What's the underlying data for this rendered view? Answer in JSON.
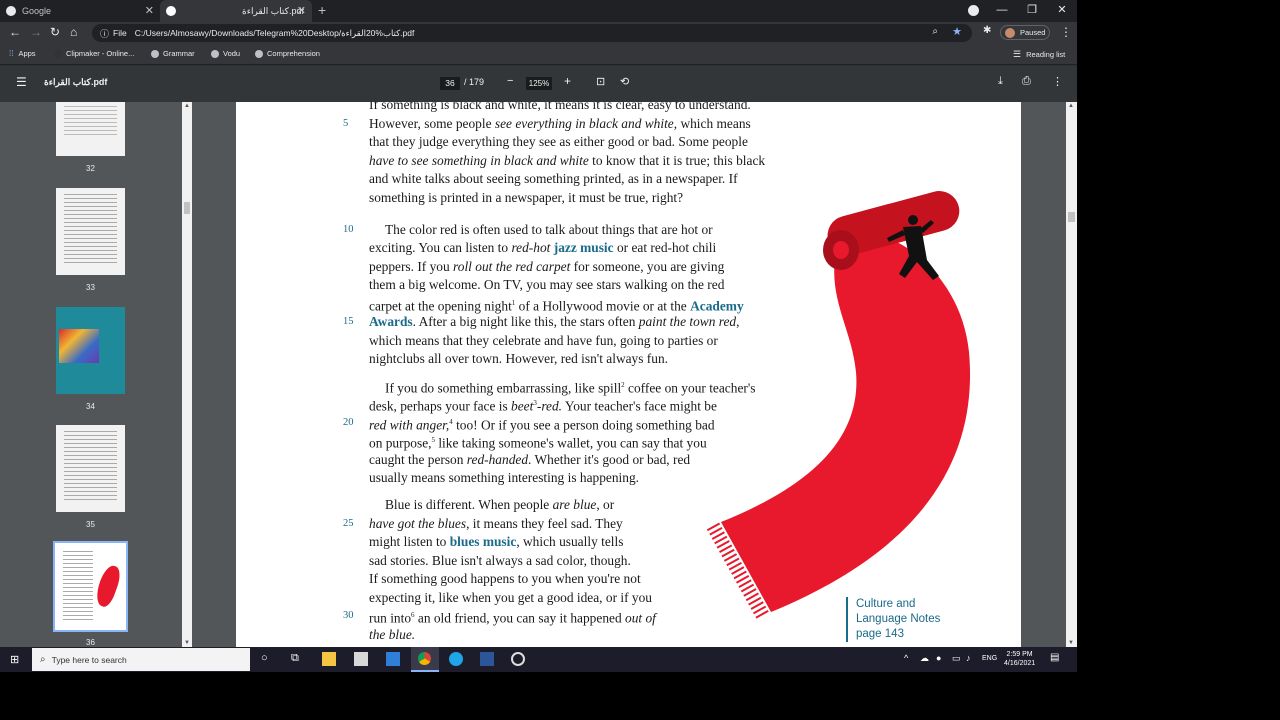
{
  "tabs": [
    {
      "label": "Google"
    },
    {
      "label": "كتاب القراءة.pdf"
    }
  ],
  "address": {
    "scheme": "File",
    "url": "C:/Users/Almosawy/Downloads/Telegram%20Desktop/كتاب%20القراءة.pdf"
  },
  "profile": {
    "label": "Paused"
  },
  "bookmarks": [
    {
      "label": "Apps"
    },
    {
      "label": "Clipmaker - Online..."
    },
    {
      "label": "Grammar"
    },
    {
      "label": "Vodu"
    },
    {
      "label": "Comprehension"
    }
  ],
  "reading_list": "Reading list",
  "pdf": {
    "title": "كتاب القراءة.pdf",
    "page": "36",
    "total": "/ 179",
    "zoom": "125%"
  },
  "thumbnails": [
    {
      "label": "32"
    },
    {
      "label": "33"
    },
    {
      "label": "34"
    },
    {
      "label": "35"
    },
    {
      "label": "36"
    }
  ],
  "text": {
    "l0": "If something is black and white, it means it is clear, easy to understand.",
    "l1a": "However, some people ",
    "l1b": "see everything in black and white",
    ", which means": "",
    "l1c": ", which means",
    "l2": "that they judge everything they see as either good or bad. Some people",
    "l3a": "have to see something in black and white",
    "l3b": " to know that it is true; this black",
    "l4": "and white talks about seeing something printed, as in a newspaper. If",
    "l5": "something is printed in a newspaper, it must be true, right?",
    "l6": "The color red is often used to talk about things that are hot or",
    "l7a": "exciting. You can listen to ",
    "l7b": "red-hot ",
    "l7c": "jazz music",
    "l7d": " or eat red-hot chili",
    "l8a": "peppers. If you ",
    "l8b": "roll out the red carpet",
    "l8c": " for someone, you are giving",
    "l9": "them a big welcome. On TV, you may see stars walking on the red",
    "l10a": "carpet at the opening night",
    "l10s": "1",
    "l10b": " of a Hollywood movie or at the ",
    "l10c": "Academy",
    "l11a": "Awards",
    "l11b": ". After a big night like this, the stars often ",
    "l11c": "paint the town red",
    ",": "",
    "l11d": ",",
    "l12": "which means that they celebrate and have fun, going to parties or",
    "l13": "nightclubs all over town. However, red isn't always fun.",
    "l14a": "If you do something embarrassing, like spill",
    "l14s": "2",
    "l14b": " coffee on your teacher's",
    "l15a": "desk, perhaps your face is ",
    "l15b": "beet",
    "l15s": "3",
    "l15c": "-red.",
    "l15d": " Your teacher's face might be",
    "l16a": "red with anger,",
    "l16s": "4",
    "l16b": " too! Or if you see a person doing something bad",
    "l17a": "on purpose,",
    "l17s": "5",
    "l17b": " like taking someone's wallet, you can say that you",
    "l18a": "caught the person ",
    "l18b": "red-handed",
    "l18c": ". Whether it's good or bad, red",
    "l19": "usually means something interesting is happening.",
    "l20a": "Blue is different. When people ",
    "l20b": "are blue",
    ", or": "",
    "l20c": ", or",
    "l21a": "have got the blues",
    "l21b": ", it means they feel sad. They",
    "l22a": "might listen to ",
    "l22b": "blues music",
    "l22c": ", which usually tells",
    "l23": "sad stories. Blue isn't always a sad color, though.",
    "l24": "If something good happens to you when you're not",
    "l25": "expecting it, like when you get a good idea, or if you",
    "l26a": "run into",
    "l26s": "6",
    "l26b": " an old friend, you can say it happened ",
    "l26c": "out of",
    "l27": "the blue."
  },
  "line_numbers": [
    "5",
    "10",
    "15",
    "20",
    "25",
    "30"
  ],
  "note": {
    "l1": "Culture and",
    "l2": "Language Notes",
    "l3": "page 143"
  },
  "taskbar": {
    "search_placeholder": "Type here to search",
    "lang": "ENG",
    "time": "2:59 PM",
    "date": "4/16/2021"
  },
  "colors": {
    "accent": "#1a6a8a",
    "carpet": "#e8192c"
  }
}
